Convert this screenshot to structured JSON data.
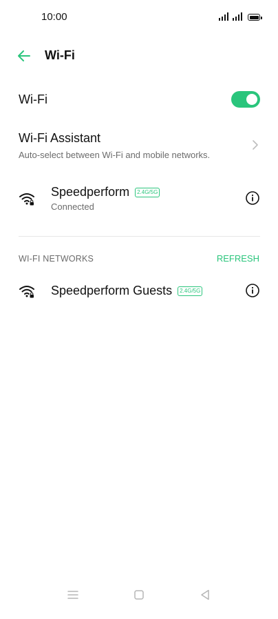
{
  "status_bar": {
    "time": "10:00",
    "icons": [
      "signal-icon",
      "signal-icon",
      "battery-icon"
    ]
  },
  "header": {
    "title": "Wi-Fi",
    "back_icon": "arrow-left-icon"
  },
  "wifi_toggle": {
    "label": "Wi-Fi",
    "enabled": true
  },
  "assistant": {
    "title": "Wi-Fi Assistant",
    "description": "Auto-select between Wi-Fi and mobile networks."
  },
  "connected_network": {
    "name": "Speedperform",
    "band": "2.4G/5G",
    "status": "Connected"
  },
  "networks_section": {
    "header": "WI-FI NETWORKS",
    "refresh_label": "REFRESH",
    "items": [
      {
        "name": "Speedperform Guests",
        "band": "2.4G/5G"
      }
    ]
  },
  "colors": {
    "accent": "#2ac57c",
    "text_primary": "#111111",
    "text_secondary": "#6b6b6b"
  }
}
